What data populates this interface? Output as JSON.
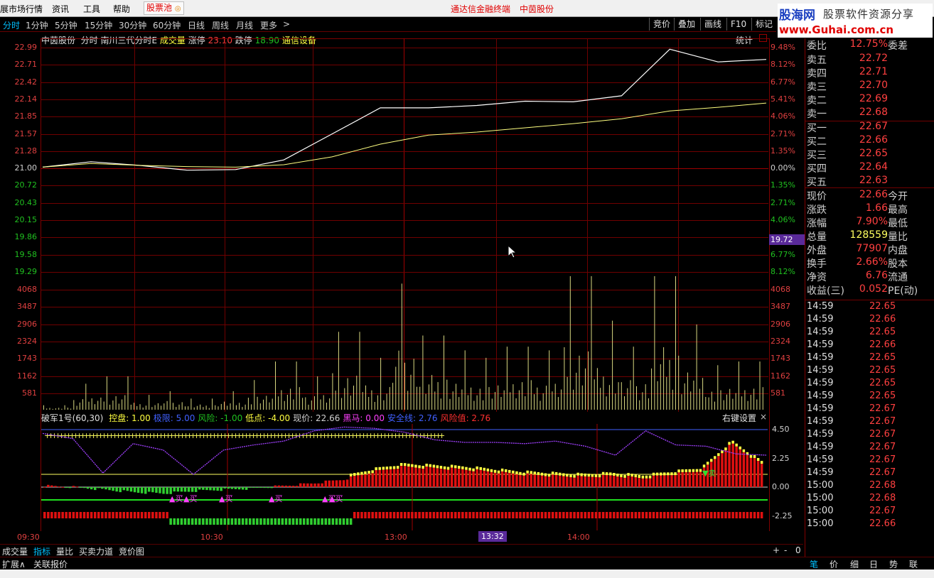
{
  "menu": {
    "items": [
      "展市场行情",
      "资讯",
      "工具",
      "帮助"
    ],
    "pool_label": "股票池",
    "center_links": [
      "通达信金融终端",
      "中茵股份"
    ]
  },
  "logo": {
    "line1": "股海网",
    "line1b": "股票软件资源分享",
    "line2": "www.Guhai.com.cn"
  },
  "tabs": [
    "分时",
    "1分钟",
    "5分钟",
    "15分钟",
    "30分钟",
    "60分钟",
    "日线",
    "周线",
    "月线",
    "更多",
    ">"
  ],
  "right_buttons": [
    "竞价",
    "叠加",
    "画线",
    "F10",
    "标记"
  ],
  "stock_line": {
    "name": "中茵股份",
    "mode": "分时",
    "indicator": "南川三代分时E",
    "vol_label": "成交量",
    "up_label": "涨停",
    "up_value": "23.10",
    "down_label": "跌停",
    "down_value": "18.90",
    "sector": "通信设备",
    "stats_label": "统计"
  },
  "price_axis": {
    "left": [
      "22.99",
      "22.71",
      "22.42",
      "22.14",
      "21.85",
      "21.57",
      "21.28",
      "21.00",
      "20.72",
      "20.43",
      "20.15",
      "19.86",
      "19.58",
      "19.29"
    ],
    "right": [
      "9.48%",
      "8.12%",
      "6.77%",
      "5.41%",
      "4.06%",
      "2.71%",
      "1.35%",
      "0.00%",
      "1.35%",
      "2.71%",
      "4.06%",
      "",
      "6.77%",
      "8.12%"
    ],
    "cursor_value": "19.72"
  },
  "vol_axis": [
    "4068",
    "3487",
    "2906",
    "2324",
    "1743",
    "1162",
    "581"
  ],
  "indicator_line": {
    "title": "破军1号(60,30)",
    "items": [
      {
        "label": "控盘: 1.00",
        "color": "#ffff40"
      },
      {
        "label": "极限: 5.00",
        "color": "#4060ff"
      },
      {
        "label": "风险: -1.00",
        "color": "#20c020"
      },
      {
        "label": "低点: -4.00",
        "color": "#ffff40"
      },
      {
        "label": "现价: 22.66",
        "color": "#d0d0d0"
      },
      {
        "label": "黑马: 0.00",
        "color": "#ff40ff"
      },
      {
        "label": "安全线: 2.76",
        "color": "#4060ff"
      },
      {
        "label": "风险值: 2.76",
        "color": "#ff3030"
      }
    ],
    "settings": "右键设置",
    "close": "×"
  },
  "ind_axis": [
    "4.50",
    "2.25",
    "0.00",
    "-2.25"
  ],
  "time_axis": [
    "09:30",
    "10:30",
    "13:00",
    "13:32",
    "14:00"
  ],
  "buy_marks": [
    "买",
    "买",
    "买",
    "买",
    "买",
    "买"
  ],
  "sell_mark": "卖",
  "bottom_tabs": [
    "成交量",
    "指标",
    "量比",
    "买卖力道",
    "竞价图"
  ],
  "bottom_tabs2": [
    "扩展∧",
    "关联报价"
  ],
  "bottom_right_tabs": [
    "笔",
    "价",
    "细",
    "日",
    "势",
    "联"
  ],
  "zoom_buttons": [
    "+",
    "-",
    "0"
  ],
  "quote": {
    "header": {
      "k": "委比",
      "v": "12.75%",
      "k2": "委差"
    },
    "asks": [
      {
        "k": "卖五",
        "v": "22.72"
      },
      {
        "k": "卖四",
        "v": "22.71"
      },
      {
        "k": "卖三",
        "v": "22.70"
      },
      {
        "k": "卖二",
        "v": "22.69"
      },
      {
        "k": "卖一",
        "v": "22.68"
      }
    ],
    "bids": [
      {
        "k": "买一",
        "v": "22.67"
      },
      {
        "k": "买二",
        "v": "22.66"
      },
      {
        "k": "买三",
        "v": "22.65"
      },
      {
        "k": "买四",
        "v": "22.64"
      },
      {
        "k": "买五",
        "v": "22.63"
      }
    ],
    "stats": [
      {
        "k": "现价",
        "v": "22.66",
        "k2": "今开"
      },
      {
        "k": "涨跌",
        "v": "1.66",
        "k2": "最高"
      },
      {
        "k": "涨幅",
        "v": "7.90%",
        "k2": "最低"
      },
      {
        "k": "总量",
        "v": "128559",
        "k2": "量比"
      },
      {
        "k": "外盘",
        "v": "77907",
        "k2": "内盘"
      },
      {
        "k": "换手",
        "v": "2.66%",
        "k2": "股本"
      },
      {
        "k": "净资",
        "v": "6.76",
        "k2": "流通"
      },
      {
        "k": "收益(三)",
        "v": "0.052",
        "k2": "PE(动)"
      }
    ],
    "ticks": [
      {
        "t": "14:59",
        "p": "22.65"
      },
      {
        "t": "14:59",
        "p": "22.66"
      },
      {
        "t": "14:59",
        "p": "22.65"
      },
      {
        "t": "14:59",
        "p": "22.66"
      },
      {
        "t": "14:59",
        "p": "22.65"
      },
      {
        "t": "14:59",
        "p": "22.65"
      },
      {
        "t": "14:59",
        "p": "22.65"
      },
      {
        "t": "14:59",
        "p": "22.65"
      },
      {
        "t": "14:59",
        "p": "22.67"
      },
      {
        "t": "14:59",
        "p": "22.67"
      },
      {
        "t": "14:59",
        "p": "22.67"
      },
      {
        "t": "14:59",
        "p": "22.67"
      },
      {
        "t": "14:59",
        "p": "22.67"
      },
      {
        "t": "14:59",
        "p": "22.67"
      },
      {
        "t": "15:00",
        "p": "22.68"
      },
      {
        "t": "15:00",
        "p": "22.68"
      },
      {
        "t": "15:00",
        "p": "22.67"
      },
      {
        "t": "15:00",
        "p": "22.66"
      }
    ]
  },
  "chart_data": {
    "type": "line",
    "x": [
      "09:30",
      "10:00",
      "10:30",
      "11:00",
      "11:30",
      "13:00",
      "13:15",
      "13:30",
      "13:45",
      "14:00",
      "14:15",
      "14:30",
      "14:40",
      "14:45",
      "14:50",
      "15:00"
    ],
    "series": [
      {
        "name": "",
        "color": "#ffffff",
        "values": [
          21.0,
          21.09,
          21.03,
          20.95,
          20.96,
          21.12,
          21.55,
          21.98,
          21.98,
          22.02,
          22.09,
          22.08,
          22.18,
          22.95,
          22.74,
          22.78
        ]
      },
      {
        "name": "",
        "color": "#ffff80",
        "values": [
          21.0,
          21.06,
          21.03,
          21.01,
          21.0,
          21.04,
          21.17,
          21.38,
          21.53,
          21.58,
          21.65,
          21.72,
          21.8,
          21.93,
          21.99,
          22.06
        ]
      }
    ],
    "ylim": [
      19.01,
      23.0
    ],
    "volume": [
      120,
      700,
      900,
      400,
      500,
      300,
      500,
      800,
      1300,
      900,
      2100,
      1400,
      3400,
      2000,
      1600,
      1400,
      1700,
      1600,
      3600,
      2400,
      1700,
      3600,
      2300,
      1200,
      1300
    ],
    "indicator": {
      "ylim": [
        -3.0,
        4.5
      ],
      "bars": [
        0.1,
        0.0,
        -0.2,
        -0.4,
        -0.5,
        -0.3,
        -0.2,
        -0.1,
        0.1,
        0.3,
        0.6,
        1.2,
        1.6,
        1.5,
        1.4,
        1.2,
        1.0,
        0.9,
        0.8,
        0.9,
        0.7,
        1.0,
        1.3,
        3.4,
        1.8
      ],
      "curve": [
        4.2,
        3.8,
        1.1,
        3.4,
        2.9,
        1.0,
        2.9,
        3.3,
        3.6,
        4.4,
        4.7,
        4.6,
        4.3,
        3.7,
        3.5,
        3.5,
        3.4,
        3.6,
        3.2,
        2.5,
        4.4,
        3.3,
        3.2,
        2.6,
        2.5
      ]
    }
  }
}
